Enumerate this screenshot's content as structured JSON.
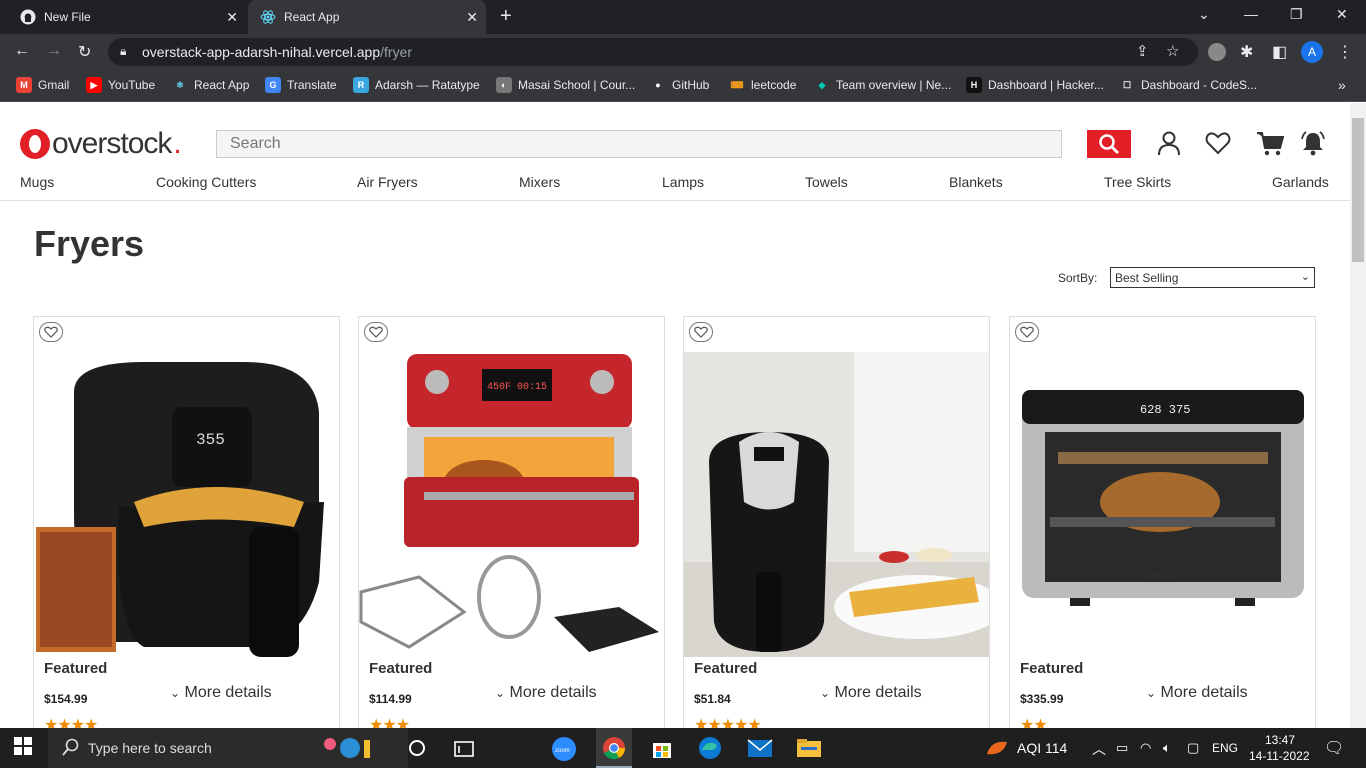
{
  "browser": {
    "tabs": [
      {
        "title": "New File",
        "icon": "github-icon"
      },
      {
        "title": "React App",
        "icon": "react-icon"
      }
    ],
    "url_host": "overstack-app-adarsh-nihal.vercel.app",
    "url_path": "/fryer",
    "profile_initial": "A",
    "bookmarks": [
      {
        "label": "Gmail",
        "color": "#ea4335",
        "glyph": "M"
      },
      {
        "label": "YouTube",
        "color": "#ff0000",
        "glyph": "▶"
      },
      {
        "label": "React App",
        "color": "#35363a",
        "glyph": "⚛"
      },
      {
        "label": "Translate",
        "color": "#4285f4",
        "glyph": "G"
      },
      {
        "label": "Adarsh — Ratatype",
        "color": "#3aa7e0",
        "glyph": "R"
      },
      {
        "label": "Masai School | Cour...",
        "color": "#777777",
        "glyph": "◐"
      },
      {
        "label": "GitHub",
        "color": "#35363a",
        "glyph": "●"
      },
      {
        "label": "leetcode",
        "color": "#35363a",
        "glyph": "⌨"
      },
      {
        "label": "Team overview | Ne...",
        "color": "#00c7b7",
        "glyph": "◆"
      },
      {
        "label": "Dashboard | Hacker...",
        "color": "#111111",
        "glyph": "H"
      },
      {
        "label": "Dashboard - CodeS...",
        "color": "#35363a",
        "glyph": "☐"
      }
    ]
  },
  "site": {
    "logo_text": "overstock",
    "logo_mark": ".",
    "search_placeholder": "Search",
    "categories": [
      "Mugs",
      "Cooking Cutters",
      "Air Fryers",
      "Mixers",
      "Lamps",
      "Towels",
      "Blankets",
      "Tree Skirts",
      "Garlands"
    ],
    "page_title": "Fryers",
    "sort_label": "SortBy:",
    "sort_value": "Best Selling"
  },
  "products": [
    {
      "badge": "Featured",
      "price": "$154.99",
      "more": "More details",
      "stars": "★★★★",
      "image": "air-fryer-black-fries"
    },
    {
      "badge": "Featured",
      "price": "$114.99",
      "more": "More details",
      "stars": "★★★",
      "image": "red-air-fryer-oven"
    },
    {
      "badge": "Featured",
      "price": "$51.84",
      "more": "More details",
      "stars": "★★★★★",
      "image": "air-fryer-with-fries"
    },
    {
      "badge": "Featured",
      "price": "$335.99",
      "more": "More details",
      "stars": "★★",
      "image": "ninja-oven-chicken"
    }
  ],
  "taskbar": {
    "search_placeholder": "Type here to search",
    "aqi": "AQI 114",
    "lang": "ENG",
    "time": "13:47",
    "date": "14-11-2022",
    "zoom_label": "zoom"
  }
}
